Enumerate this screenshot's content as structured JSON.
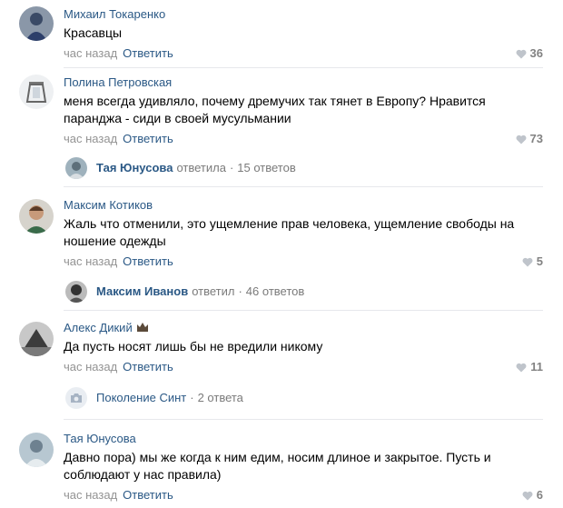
{
  "comments": [
    {
      "author": "Михаил Токаренко",
      "text": "Красавцы",
      "time": "час назад",
      "reply": "Ответить",
      "likes": "36"
    },
    {
      "author": "Полина Петровская",
      "text": "меня всегда удивляло, почему дремучих так тянет в Европу? Нравится паранджа - сиди в своей мусульмании",
      "time": "час назад",
      "reply": "Ответить",
      "likes": "73",
      "thread": {
        "name": "Тая Юнусова",
        "verb": "ответила",
        "sep": "·",
        "count": "15 ответов"
      }
    },
    {
      "author": "Максим Котиков",
      "text": "Жаль что отменили, это ущемление прав человека, ущемление свободы на ношение одежды",
      "time": "час назад",
      "reply": "Ответить",
      "likes": "5",
      "thread": {
        "name": "Максим Иванов",
        "verb": "ответил",
        "sep": "·",
        "count": "46 ответов"
      }
    },
    {
      "author": "Алекс Дикий",
      "text": "Да пусть носят лишь бы не вредили никому",
      "time": "час назад",
      "reply": "Ответить",
      "likes": "11",
      "thread": {
        "name": "Поколение Синт",
        "sep": "·",
        "count": "2 ответа"
      }
    },
    {
      "author": "Тая Юнусова",
      "text": "Давно пора) мы же когда к ним едим, носим длиное и закрытое. Пусть и соблюдают у нас правила)",
      "time": "час назад",
      "reply": "Ответить",
      "likes": "6"
    }
  ],
  "colors": {
    "link": "#2a5885",
    "meta": "#939393",
    "divider": "#e7e8ec"
  },
  "icons": {
    "like": "heart-icon",
    "badge": "crown-icon",
    "camera": "camera-icon"
  }
}
